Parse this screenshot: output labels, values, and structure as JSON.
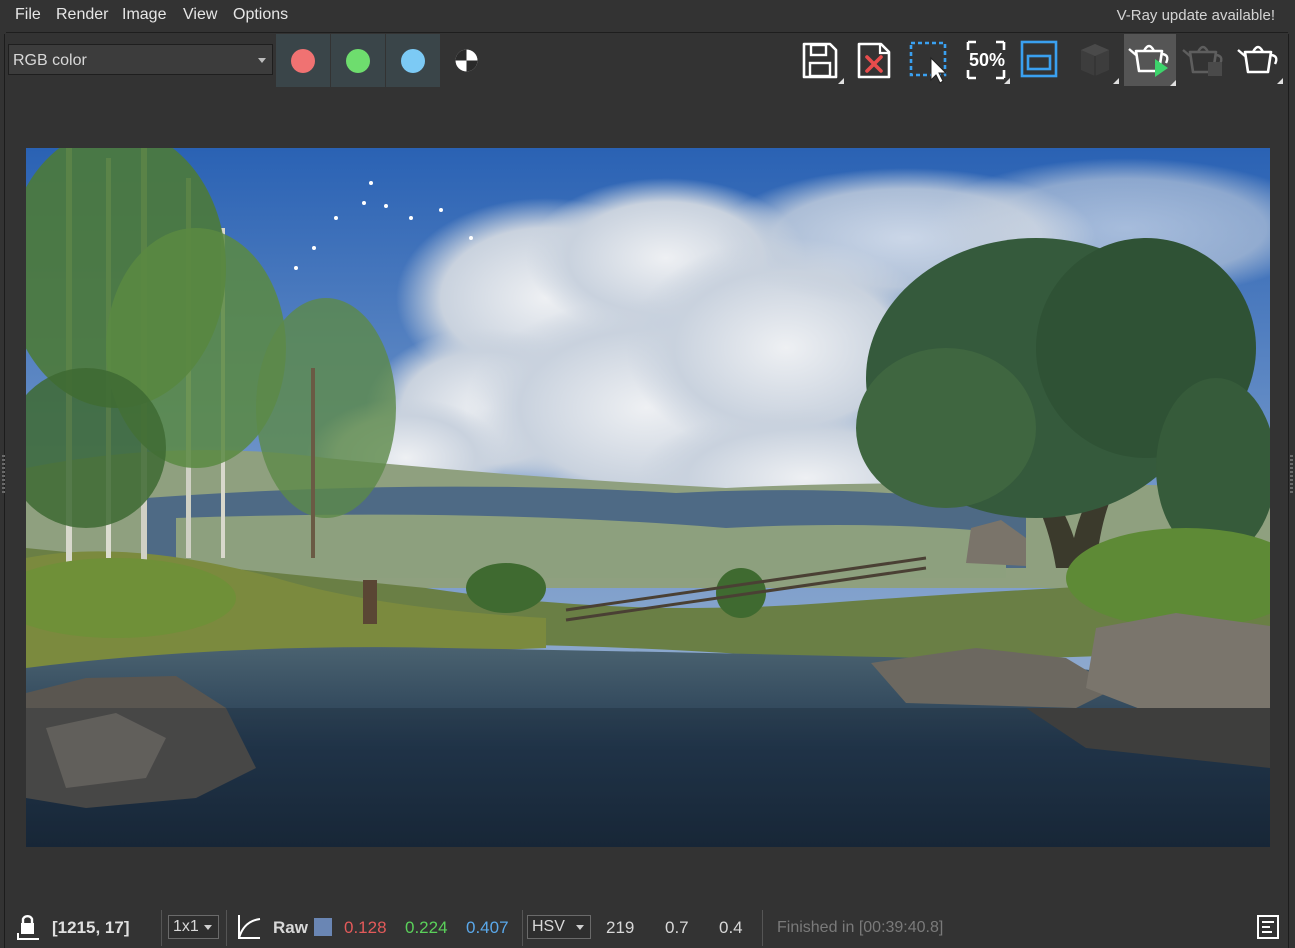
{
  "menu": {
    "items": [
      "File",
      "Render",
      "Image",
      "View",
      "Options"
    ],
    "notice": "V-Ray update available!"
  },
  "toolbar": {
    "channel": "RGB color",
    "channel_buttons": [
      {
        "name": "red",
        "color": "#f07272"
      },
      {
        "name": "green",
        "color": "#6edd6e"
      },
      {
        "name": "blue",
        "color": "#7ccaf5"
      }
    ],
    "zoom_label": "50%",
    "icons": [
      "save-icon",
      "clear-image-icon",
      "region-render-icon",
      "zoom-50-icon",
      "frame-icon",
      "render-3d-icon",
      "interactive-render-icon",
      "stop-render-icon",
      "render-icon"
    ]
  },
  "status": {
    "coords": "[1215, 17]",
    "sample_size": "1x1",
    "raw_label": "Raw",
    "swatch_color": "#6a86b4",
    "r": "0.128",
    "g": "0.224",
    "b": "0.407",
    "color_space": "HSV",
    "h": "219",
    "s": "0.7",
    "v": "0.4",
    "render_status": "Finished in [00:39:40.8]"
  }
}
